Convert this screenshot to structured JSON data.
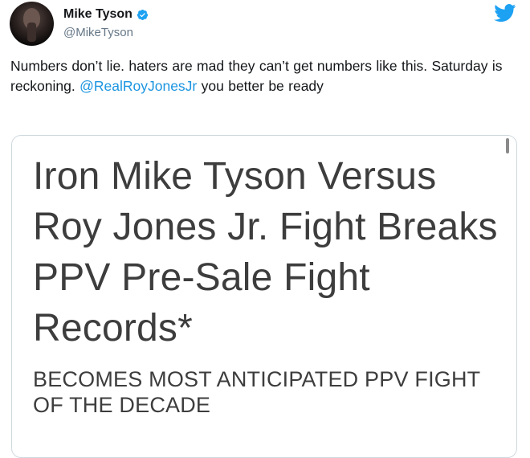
{
  "author": {
    "name": "Mike Tyson",
    "handle": "@MikeTyson"
  },
  "tweet": {
    "text_before": "Numbers don’t lie.  haters are mad they can’t get numbers like this.  Saturday is reckoning. ",
    "mention": "@RealRoyJonesJr",
    "text_after": " you better be ready"
  },
  "card": {
    "headline": "Iron Mike Tyson Versus Roy Jones Jr. Fight Breaks PPV Pre-Sale Fight Records*",
    "subheadline": "BECOMES MOST ANTICIPATED PPV FIGHT OF THE DECADE"
  },
  "icons": {
    "avatar": "profile-photo",
    "verified": "verified-badge-icon",
    "brand": "twitter-bird-icon"
  },
  "colors": {
    "link": "#1b95e0",
    "verified": "#1da1f2",
    "twitter_brand": "#1da1f2",
    "text": "#14171a",
    "secondary": "#657786"
  }
}
